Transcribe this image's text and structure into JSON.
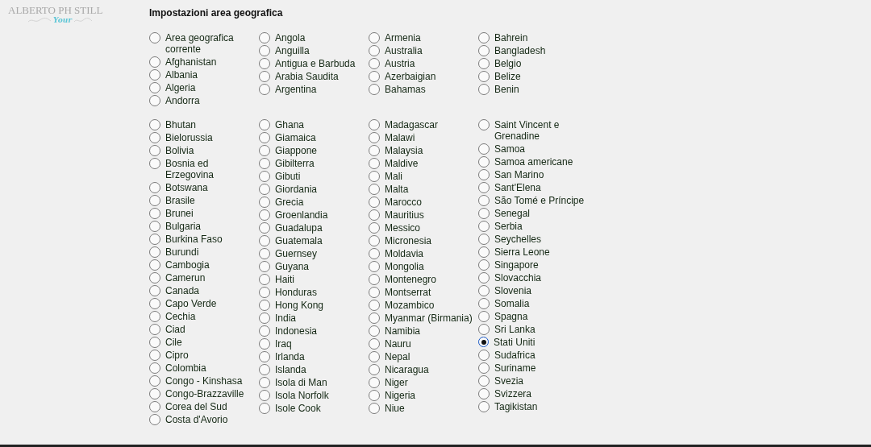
{
  "logo": {
    "name": "ALBERTO PH STILL",
    "tagline_word": "Your"
  },
  "title": "Impostazioni area geografica",
  "groups": [
    {
      "columns": [
        [
          {
            "label": "Area geografica corrente",
            "selected": false
          },
          {
            "label": "Afghanistan",
            "selected": false
          },
          {
            "label": "Albania",
            "selected": false
          },
          {
            "label": "Algeria",
            "selected": false
          },
          {
            "label": "Andorra",
            "selected": false
          }
        ],
        [
          {
            "label": "Angola",
            "selected": false
          },
          {
            "label": "Anguilla",
            "selected": false
          },
          {
            "label": "Antigua e Barbuda",
            "selected": false
          },
          {
            "label": "Arabia Saudita",
            "selected": false
          },
          {
            "label": "Argentina",
            "selected": false
          }
        ],
        [
          {
            "label": "Armenia",
            "selected": false
          },
          {
            "label": "Australia",
            "selected": false
          },
          {
            "label": "Austria",
            "selected": false
          },
          {
            "label": "Azerbaigian",
            "selected": false
          },
          {
            "label": "Bahamas",
            "selected": false
          }
        ],
        [
          {
            "label": "Bahrein",
            "selected": false
          },
          {
            "label": "Bangladesh",
            "selected": false
          },
          {
            "label": "Belgio",
            "selected": false
          },
          {
            "label": "Belize",
            "selected": false
          },
          {
            "label": "Benin",
            "selected": false
          }
        ]
      ]
    },
    {
      "columns": [
        [
          {
            "label": "Bhutan",
            "selected": false
          },
          {
            "label": "Bielorussia",
            "selected": false
          },
          {
            "label": "Bolivia",
            "selected": false
          },
          {
            "label": "Bosnia ed Erzegovina",
            "selected": false
          },
          {
            "label": "Botswana",
            "selected": false
          },
          {
            "label": "Brasile",
            "selected": false
          },
          {
            "label": "Brunei",
            "selected": false
          },
          {
            "label": "Bulgaria",
            "selected": false
          },
          {
            "label": "Burkina Faso",
            "selected": false
          },
          {
            "label": "Burundi",
            "selected": false
          },
          {
            "label": "Cambogia",
            "selected": false
          },
          {
            "label": "Camerun",
            "selected": false
          },
          {
            "label": "Canada",
            "selected": false
          },
          {
            "label": "Capo Verde",
            "selected": false
          },
          {
            "label": "Cechia",
            "selected": false
          },
          {
            "label": "Ciad",
            "selected": false
          },
          {
            "label": "Cile",
            "selected": false
          },
          {
            "label": "Cipro",
            "selected": false
          },
          {
            "label": "Colombia",
            "selected": false
          },
          {
            "label": "Congo - Kinshasa",
            "selected": false
          },
          {
            "label": "Congo-Brazzaville",
            "selected": false
          },
          {
            "label": "Corea del Sud",
            "selected": false
          },
          {
            "label": "Costa d'Avorio",
            "selected": false
          }
        ],
        [
          {
            "label": "Ghana",
            "selected": false
          },
          {
            "label": "Giamaica",
            "selected": false
          },
          {
            "label": "Giappone",
            "selected": false
          },
          {
            "label": "Gibilterra",
            "selected": false
          },
          {
            "label": "Gibuti",
            "selected": false
          },
          {
            "label": "Giordania",
            "selected": false
          },
          {
            "label": "Grecia",
            "selected": false
          },
          {
            "label": "Groenlandia",
            "selected": false
          },
          {
            "label": "Guadalupa",
            "selected": false
          },
          {
            "label": "Guatemala",
            "selected": false
          },
          {
            "label": "Guernsey",
            "selected": false
          },
          {
            "label": "Guyana",
            "selected": false
          },
          {
            "label": "Haiti",
            "selected": false
          },
          {
            "label": "Honduras",
            "selected": false
          },
          {
            "label": "Hong Kong",
            "selected": false
          },
          {
            "label": "India",
            "selected": false
          },
          {
            "label": "Indonesia",
            "selected": false
          },
          {
            "label": "Iraq",
            "selected": false
          },
          {
            "label": "Irlanda",
            "selected": false
          },
          {
            "label": "Islanda",
            "selected": false
          },
          {
            "label": "Isola di Man",
            "selected": false
          },
          {
            "label": "Isola Norfolk",
            "selected": false
          },
          {
            "label": "Isole Cook",
            "selected": false
          }
        ],
        [
          {
            "label": "Madagascar",
            "selected": false
          },
          {
            "label": "Malawi",
            "selected": false
          },
          {
            "label": "Malaysia",
            "selected": false
          },
          {
            "label": "Maldive",
            "selected": false
          },
          {
            "label": "Mali",
            "selected": false
          },
          {
            "label": "Malta",
            "selected": false
          },
          {
            "label": "Marocco",
            "selected": false
          },
          {
            "label": "Mauritius",
            "selected": false
          },
          {
            "label": "Messico",
            "selected": false
          },
          {
            "label": "Micronesia",
            "selected": false
          },
          {
            "label": "Moldavia",
            "selected": false
          },
          {
            "label": "Mongolia",
            "selected": false
          },
          {
            "label": "Montenegro",
            "selected": false
          },
          {
            "label": "Montserrat",
            "selected": false
          },
          {
            "label": "Mozambico",
            "selected": false
          },
          {
            "label": "Myanmar (Birmania)",
            "selected": false
          },
          {
            "label": "Namibia",
            "selected": false
          },
          {
            "label": "Nauru",
            "selected": false
          },
          {
            "label": "Nepal",
            "selected": false
          },
          {
            "label": "Nicaragua",
            "selected": false
          },
          {
            "label": "Niger",
            "selected": false
          },
          {
            "label": "Nigeria",
            "selected": false
          },
          {
            "label": "Niue",
            "selected": false
          }
        ],
        [
          {
            "label": "Saint Vincent e Grenadine",
            "selected": false
          },
          {
            "label": "Samoa",
            "selected": false
          },
          {
            "label": "Samoa americane",
            "selected": false
          },
          {
            "label": "San Marino",
            "selected": false
          },
          {
            "label": "Sant'Elena",
            "selected": false
          },
          {
            "label": "São Tomé e Príncipe",
            "selected": false
          },
          {
            "label": "Senegal",
            "selected": false
          },
          {
            "label": "Serbia",
            "selected": false
          },
          {
            "label": "Seychelles",
            "selected": false
          },
          {
            "label": "Sierra Leone",
            "selected": false
          },
          {
            "label": "Singapore",
            "selected": false
          },
          {
            "label": "Slovacchia",
            "selected": false
          },
          {
            "label": "Slovenia",
            "selected": false
          },
          {
            "label": "Somalia",
            "selected": false
          },
          {
            "label": "Spagna",
            "selected": false
          },
          {
            "label": "Sri Lanka",
            "selected": false
          },
          {
            "label": "Stati Uniti",
            "selected": true
          },
          {
            "label": "Sudafrica",
            "selected": false
          },
          {
            "label": "Suriname",
            "selected": false
          },
          {
            "label": "Svezia",
            "selected": false
          },
          {
            "label": "Svizzera",
            "selected": false
          },
          {
            "label": "Tagikistan",
            "selected": false
          }
        ]
      ]
    }
  ]
}
